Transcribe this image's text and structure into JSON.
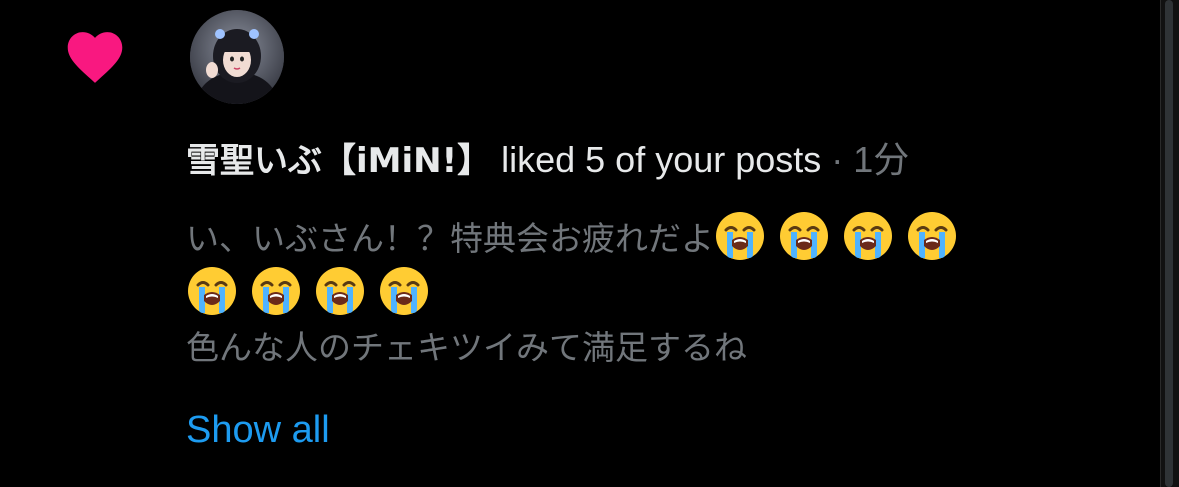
{
  "notification": {
    "type_icon": "heart-icon",
    "icon_color": "#f91880",
    "avatar_icon": "user-avatar",
    "user_name": "雪聖いぶ【iMiN!】",
    "action_text": " liked 5 of your posts",
    "separator": " · ",
    "timestamp": "1分",
    "post_lines": [
      "い、いぶさん！？特典会お疲れだよ",
      "",
      "色んな人のチェキツイみて満足するね"
    ],
    "emoji_name": "loudly-crying-face",
    "show_all_label": "Show all"
  },
  "colors": {
    "background": "#000000",
    "primary_text": "#e7e9ea",
    "secondary_text": "#71767b",
    "link": "#1d9bf0",
    "like": "#f91880"
  }
}
